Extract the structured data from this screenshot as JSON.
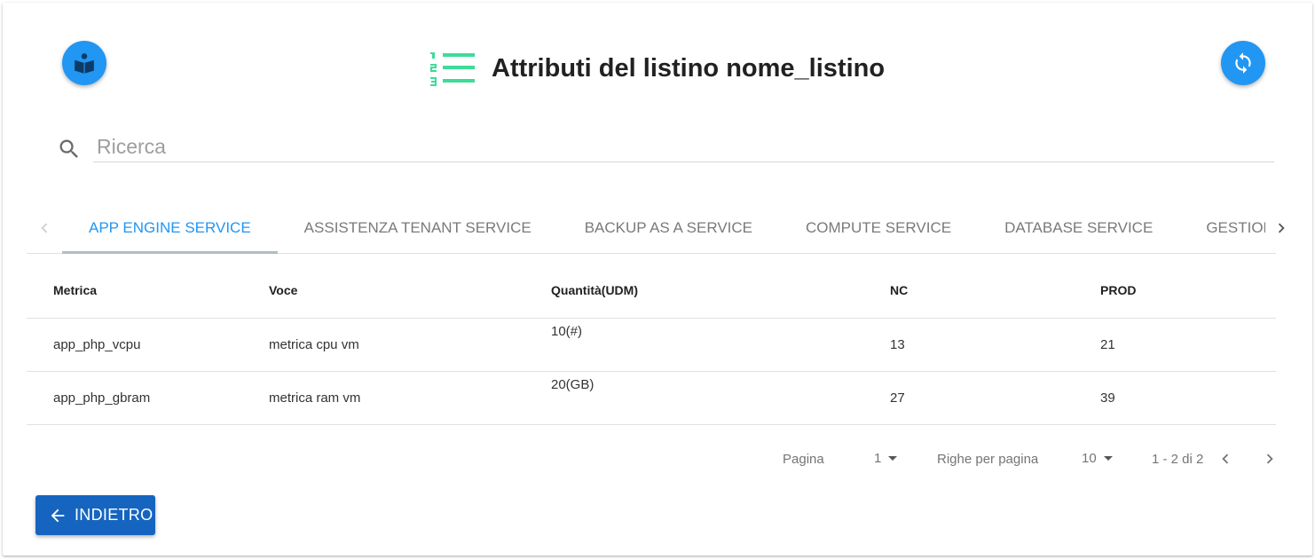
{
  "header": {
    "title": "Attributi del listino nome_listino",
    "left_icon": "book-reader-icon",
    "right_icon": "refresh-icon",
    "title_icon": "numbered-list-icon",
    "accent_color": "#2196f3",
    "title_icon_color": "#3ddc97"
  },
  "search": {
    "placeholder": "Ricerca",
    "value": ""
  },
  "tabs": [
    {
      "label": "APP ENGINE SERVICE",
      "active": true
    },
    {
      "label": "ASSISTENZA TENANT SERVICE",
      "active": false
    },
    {
      "label": "BACKUP AS A SERVICE",
      "active": false
    },
    {
      "label": "COMPUTE SERVICE",
      "active": false
    },
    {
      "label": "DATABASE SERVICE",
      "active": false
    },
    {
      "label": "GESTIONE",
      "active": false
    }
  ],
  "table": {
    "columns": [
      "Metrica",
      "Voce",
      "Quantità(UDM)",
      "NC",
      "PROD"
    ],
    "rows": [
      {
        "metrica": "app_php_vcpu",
        "voce": "metrica cpu vm",
        "quantita": "10(#)",
        "nc": "13",
        "prod": "21"
      },
      {
        "metrica": "app_php_gbram",
        "voce": "metrica ram vm",
        "quantita": "20(GB)",
        "nc": "27",
        "prod": "39"
      }
    ]
  },
  "pagination": {
    "page_label": "Pagina",
    "page_value": "1",
    "rows_label": "Righe per pagina",
    "rows_value": "10",
    "range": "1 - 2 di 2"
  },
  "back_button": {
    "label": "INDIETRO",
    "color": "#1565c0"
  }
}
